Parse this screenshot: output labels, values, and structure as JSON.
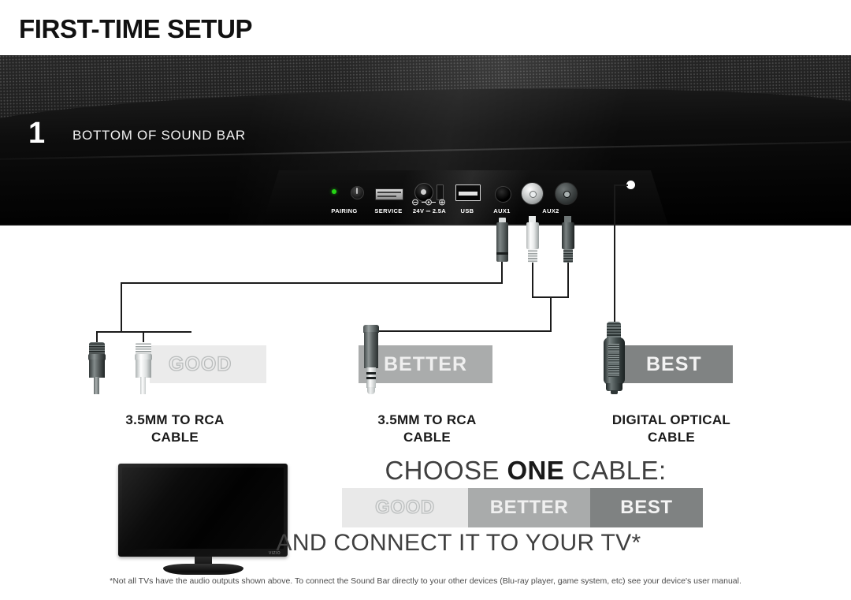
{
  "page": {
    "title": "FIRST-TIME SETUP"
  },
  "step": {
    "number": "1",
    "label": "BOTTOM OF SOUND BAR"
  },
  "ports": [
    {
      "name": "pairing-port",
      "label": "PAIRING"
    },
    {
      "name": "service-port",
      "label": "SERVICE"
    },
    {
      "name": "power-port",
      "label": "24V ═ 2.5A"
    },
    {
      "name": "usb-port",
      "label": "USB"
    },
    {
      "name": "aux1-port",
      "label": "AUX1"
    },
    {
      "name": "aux2-port",
      "label": "AUX2"
    }
  ],
  "cable_options": [
    {
      "rank": "GOOD",
      "caption_line1": "3.5MM TO RCA",
      "caption_line2": "CABLE",
      "badge_color": "#ebebeb"
    },
    {
      "rank": "BETTER",
      "caption_line1": "3.5MM TO RCA",
      "caption_line2": "CABLE",
      "badge_color": "#aaacac"
    },
    {
      "rank": "BEST",
      "caption_line1": "DIGITAL OPTICAL",
      "caption_line2": "CABLE",
      "badge_color": "#808383"
    }
  ],
  "instruction": {
    "choose_prefix": "CHOOSE ",
    "choose_emphasis": "ONE",
    "choose_suffix": " CABLE:",
    "strip": [
      "GOOD",
      "BETTER",
      "BEST"
    ],
    "connect": "AND CONNECT IT TO YOUR TV*"
  },
  "tv": {
    "brand": "VIZIO"
  },
  "footnote": "*Not all TVs have the audio outputs shown above. To connect the Sound Bar directly to your other devices (Blu-ray player, game system, etc) see your device's user manual."
}
